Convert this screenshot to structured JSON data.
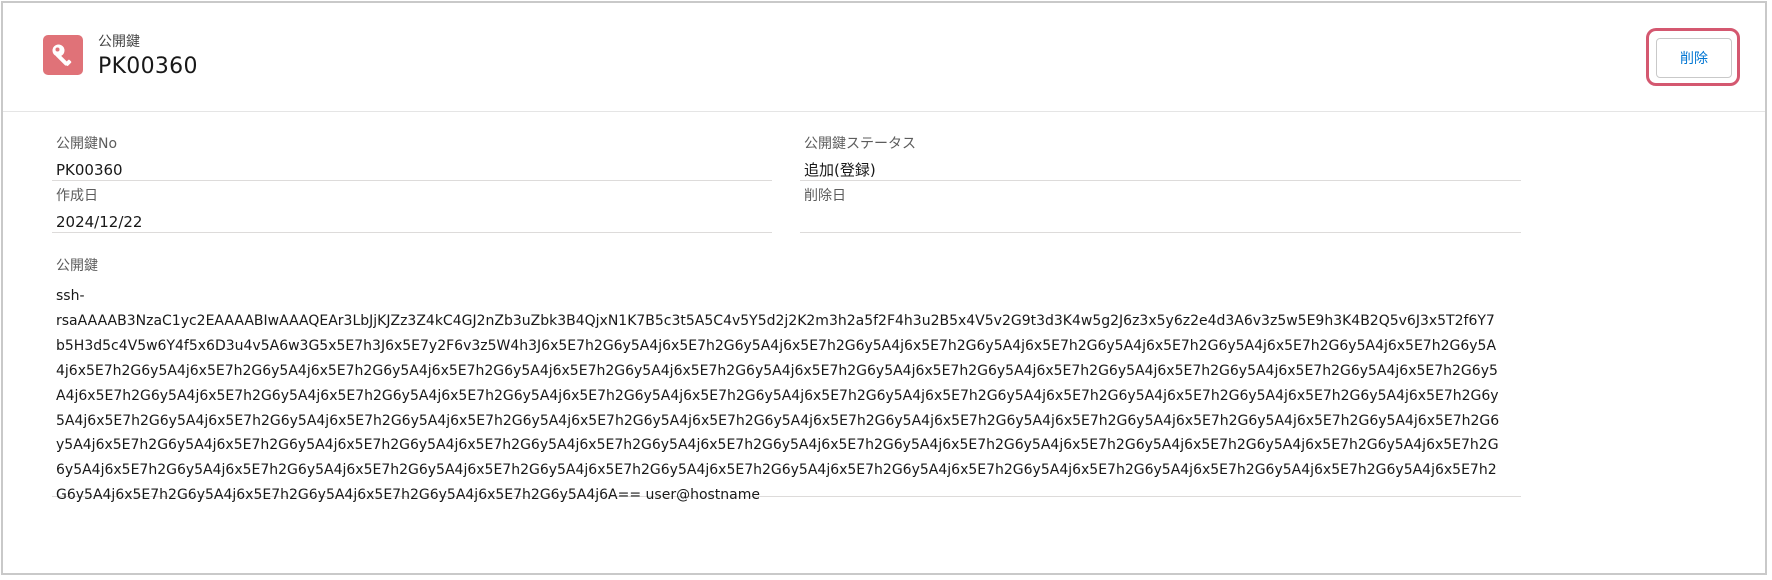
{
  "header": {
    "object_label": "公開鍵",
    "record_title": "PK00360",
    "icon": "key-icon",
    "delete_label": "削除"
  },
  "fields": {
    "key_no": {
      "label": "公開鍵No",
      "value": "PK00360"
    },
    "key_status": {
      "label": "公開鍵ステータス",
      "value": "追加(登録)"
    },
    "created_date": {
      "label": "作成日",
      "value": "2024/12/22"
    },
    "deleted_date": {
      "label": "削除日",
      "value": ""
    },
    "public_key": {
      "label": "公開鍵",
      "value": "ssh-\nrsaAAAAB3NzaC1yc2EAAAABIwAAAQEAr3LbJjKJZz3Z4kC4GJ2nZb3uZbk3B4QjxN1K7B5c3t5A5C4v5Y5d2j2K2m3h2a5f2F4h3u2B5x4V5v2G9t3d3K4w5g2J6z3x5y6z2e4d3A6v3z5w5E9h3K4B2Q5v6J3x5T2f6Y7b5H3d5c4V5w6Y4f5x6D3u4v5A6w3G5x5E7h3J6x5E7y2F6v3z5W4h3J6x5E7h2G6y5A4j6x5E7h2G6y5A4j6x5E7h2G6y5A4j6x5E7h2G6y5A4j6x5E7h2G6y5A4j6x5E7h2G6y5A4j6x5E7h2G6y5A4j6x5E7h2G6y5A4j6x5E7h2G6y5A4j6x5E7h2G6y5A4j6x5E7h2G6y5A4j6x5E7h2G6y5A4j6x5E7h2G6y5A4j6x5E7h2G6y5A4j6x5E7h2G6y5A4j6x5E7h2G6y5A4j6x5E7h2G6y5A4j6x5E7h2G6y5A4j6x5E7h2G6y5A4j6x5E7h2G6y5A4j6x5E7h2G6y5A4j6x5E7h2G6y5A4j6x5E7h2G6y5A4j6x5E7h2G6y5A4j6x5E7h2G6y5A4j6x5E7h2G6y5A4j6x5E7h2G6y5A4j6x5E7h2G6y5A4j6x5E7h2G6y5A4j6x5E7h2G6y5A4j6x5E7h2G6y5A4j6x5E7h2G6y5A4j6x5E7h2G6y5A4j6x5E7h2G6y5A4j6x5E7h2G6y5A4j6x5E7h2G6y5A4j6x5E7h2G6y5A4j6x5E7h2G6y5A4j6x5E7h2G6y5A4j6x5E7h2G6y5A4j6x5E7h2G6y5A4j6x5E7h2G6y5A4j6x5E7h2G6y5A4j6x5E7h2G6y5A4j6x5E7h2G6y5A4j6x5E7h2G6y5A4j6x5E7h2G6y5A4j6x5E7h2G6y5A4j6x5E7h2G6y5A4j6x5E7h2G6y5A4j6x5E7h2G6y5A4j6x5E7h2G6y5A4j6x5E7h2G6y5A4j6x5E7h2G6y5A4j6x5E7h2G6y5A4j6x5E7h2G6y5A4j6x5E7h2G6y5A4j6x5E7h2G6y5A4j6x5E7h2G6y5A4j6x5E7h2G6y5A4j6x5E7h2G6y5A4j6x5E7h2G6y5A4j6x5E7h2G6y5A4j6x5E7h2G6y5A4j6x5E7h2G6y5A4j6x5E7h2G6y5A4j6x5E7h2G6y5A4j6x5E7h2G6y5A4j6x5E7h2G6y5A4j6x5E7h2G6y5A4j6x5E7h2G6y5A4j6x5E7h2G6y5A4j6A== user@hostname"
    }
  },
  "colors": {
    "icon_bg": "#e07278",
    "highlight_border": "#d45870",
    "button_text": "#0176d3",
    "label_text": "#5c5c5c"
  }
}
